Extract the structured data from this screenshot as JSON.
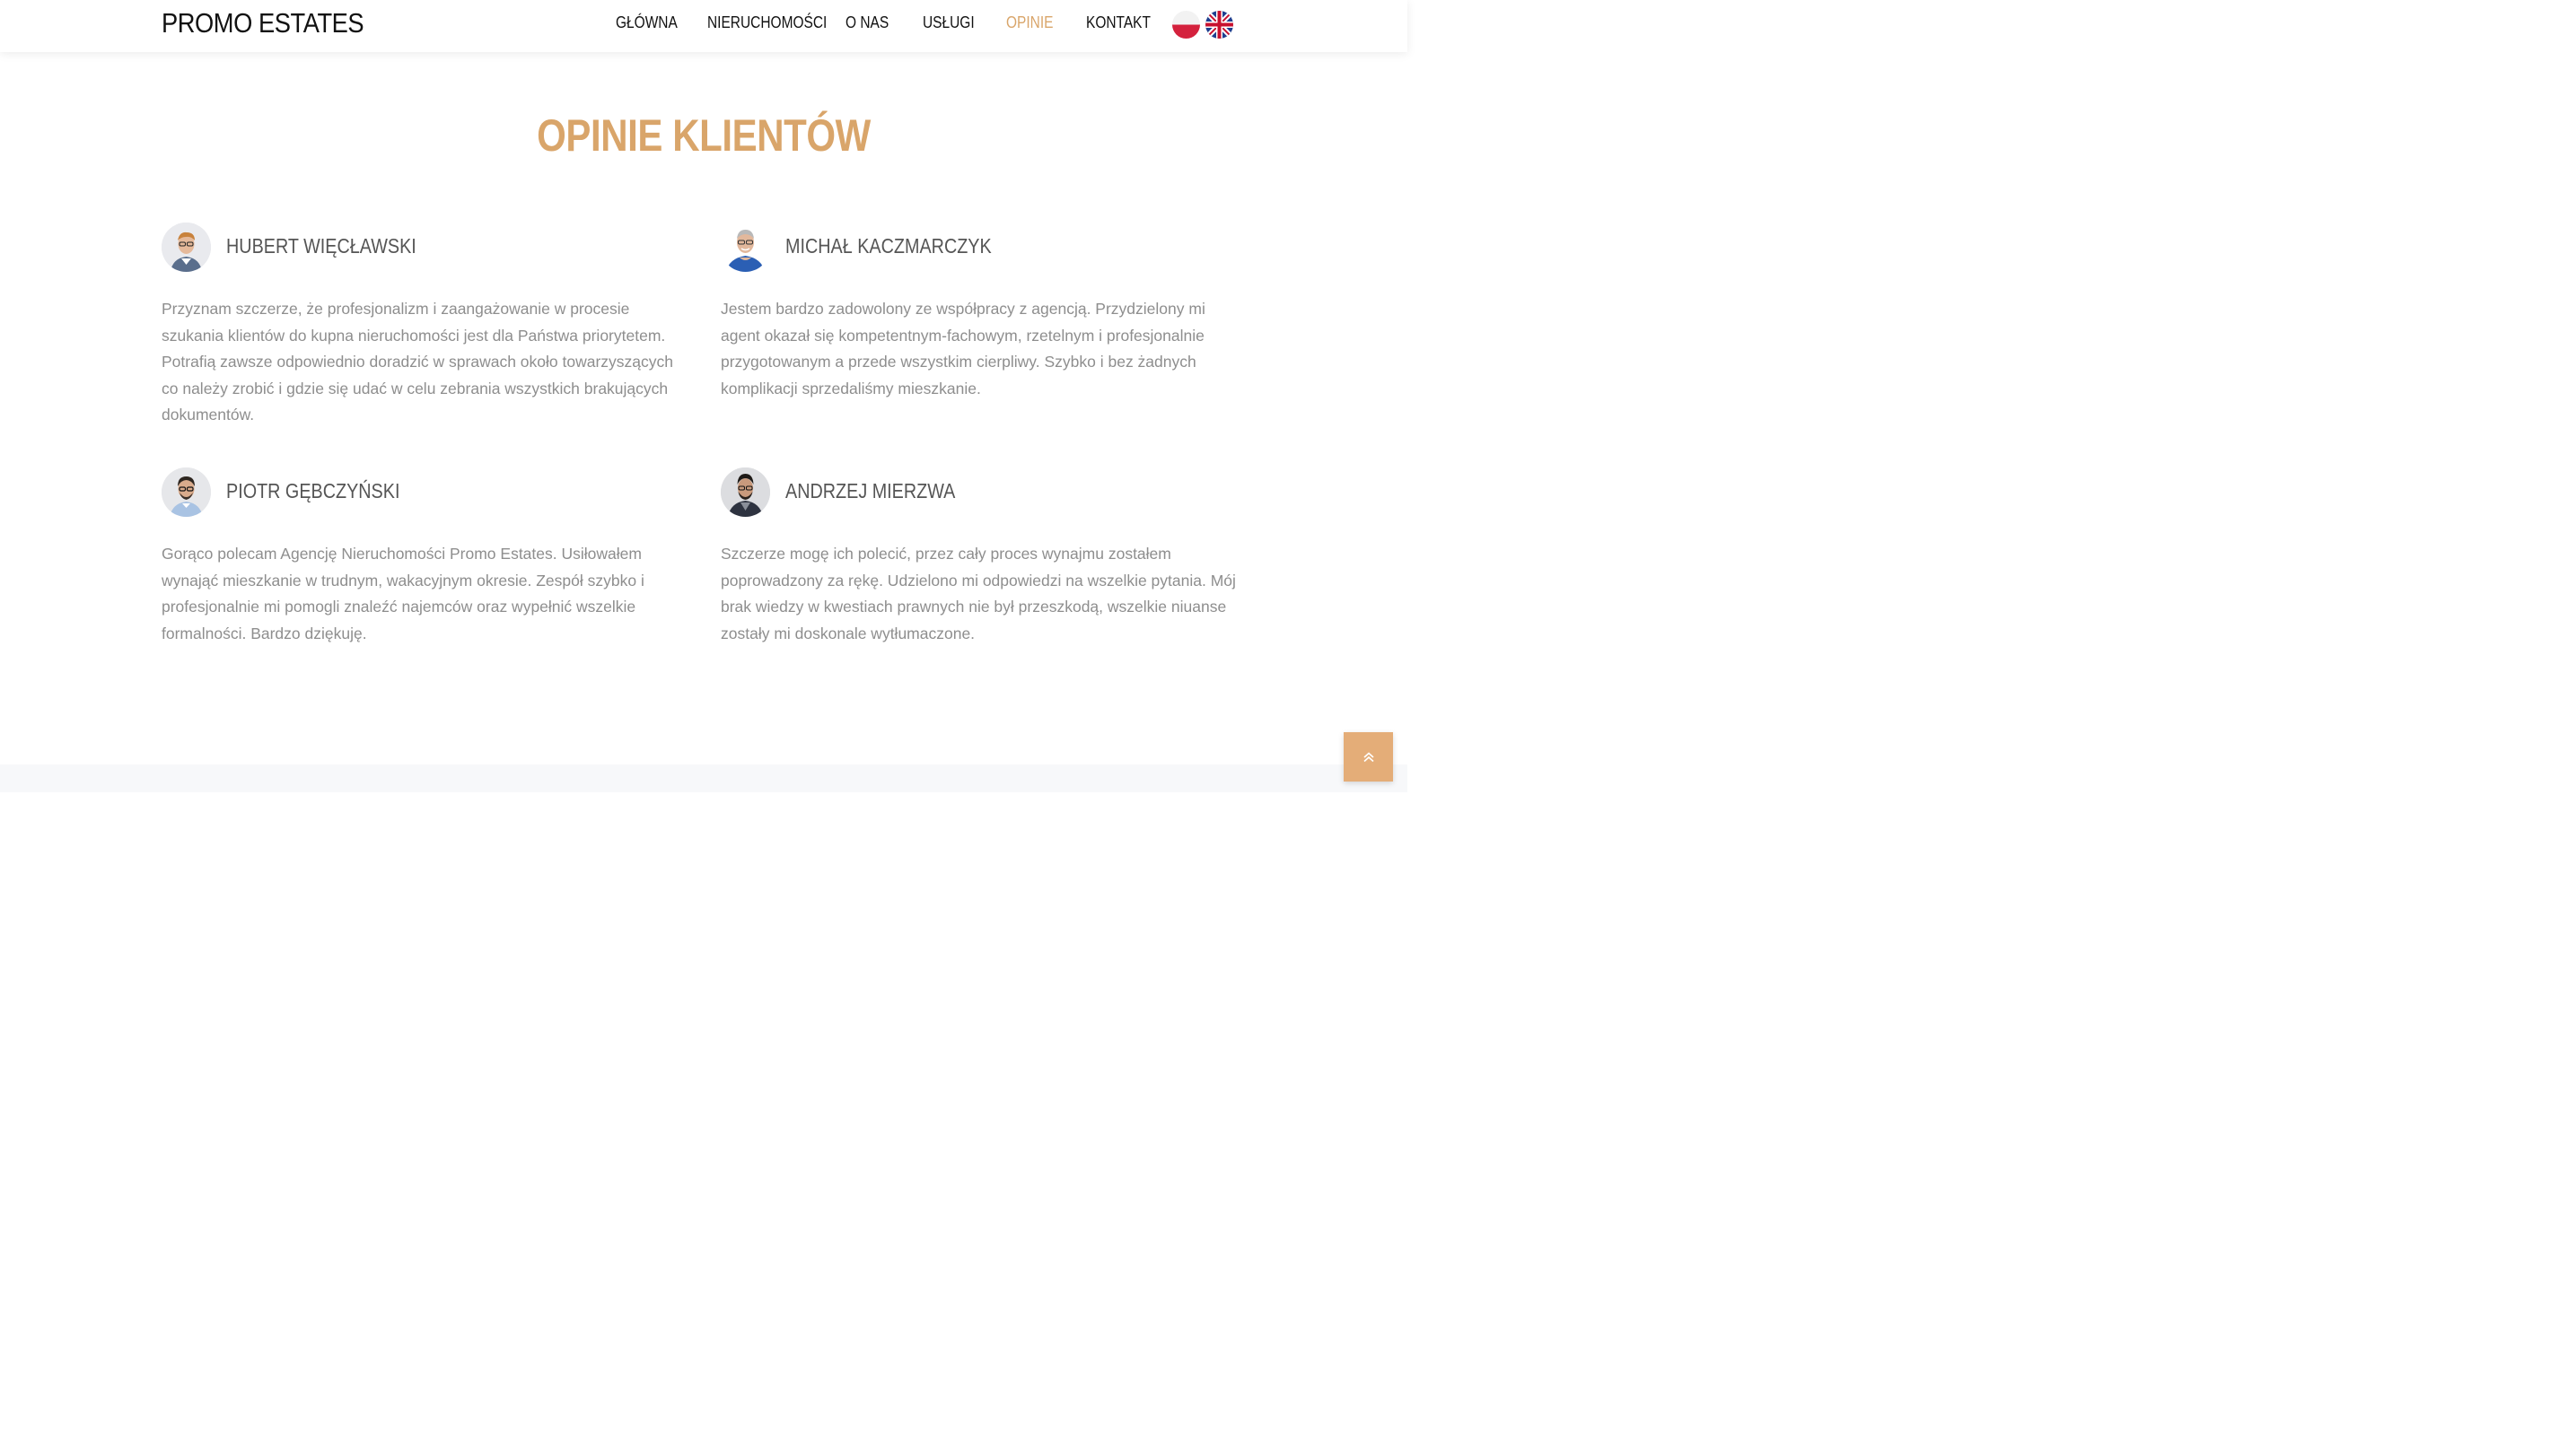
{
  "header": {
    "logo": "PROMO ESTATES",
    "nav": [
      {
        "label": "GŁÓWNA",
        "active": false
      },
      {
        "label": "NIERUCHOMOŚCI",
        "active": false
      },
      {
        "label": "O NAS",
        "active": false
      },
      {
        "label": "USŁUGI",
        "active": false
      },
      {
        "label": "OPINIE",
        "active": true
      },
      {
        "label": "KONTAKT",
        "active": false
      }
    ],
    "languages": [
      {
        "icon": "poland-flag-icon"
      },
      {
        "icon": "uk-flag-icon"
      }
    ]
  },
  "section": {
    "title": "OPINIE KLIENTÓW"
  },
  "testimonials": [
    {
      "name": "HUBERT WIĘCŁAWSKI",
      "text": "Przyznam szczerze, że profesjonalizm i zaangażowanie w procesie szukania klientów do kupna nieruchomości jest dla Państwa priorytetem. Potrafią zawsze odpowiednio doradzić w sprawach około towarzyszących co należy zrobić i gdzie się udać w celu zebrania wszystkich brakujących dokumentów."
    },
    {
      "name": "MICHAŁ KACZMARCZYK",
      "text": "Jestem bardzo zadowolony ze współpracy z agencją. Przydzielony mi agent okazał się kompetentnym-fachowym, rzetelnym i profesjonalnie przygotowanym a przede wszystkim cierpliwy. Szybko i bez żadnych komplikacji sprzedaliśmy mieszkanie."
    },
    {
      "name": "PIOTR GĘBCZYŃSKI",
      "text": "Gorąco polecam Agencję Nieruchomości Promo Estates. Usiłowałem wynająć mieszkanie w trudnym, wakacyjnym okresie. Zespół szybko i profesjonalnie mi pomogli znaleźć najemców oraz wypełnić wszelkie formalności. Bardzo dziękuję."
    },
    {
      "name": "ANDRZEJ MIERZWA",
      "text": "Szczerze mogę ich polecić, przez cały proces wynajmu zostałem poprowadzony za rękę. Udzielono mi odpowiedzi na wszelkie pytania. Mój brak wiedzy w kwestiach prawnych nie był przeszkodą, wszelkie niuanse zostały mi doskonale wytłumaczone."
    }
  ],
  "scroll_top": {
    "icon": "double-chevron-up-icon"
  },
  "colors": {
    "accent": "#d9a56a",
    "button": "#e4ad78",
    "text": "#8e8e8e"
  }
}
